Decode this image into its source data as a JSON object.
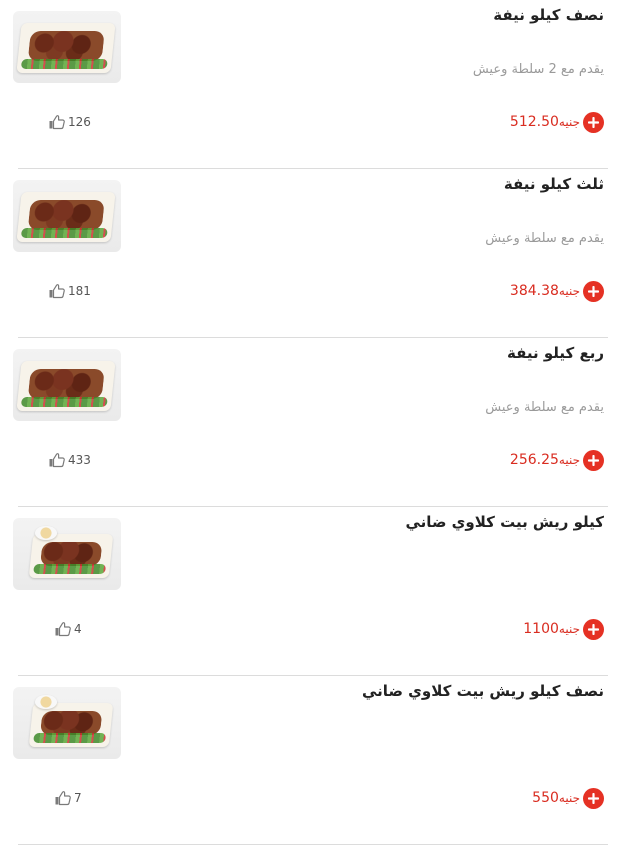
{
  "colors": {
    "accent": "#e53124",
    "price": "#d92c20",
    "subtitle": "#9a9a9a",
    "divider": "#dcdcdc"
  },
  "icons": {
    "add": "plus-circle-icon",
    "like": "thumbs-up-icon"
  },
  "items": [
    {
      "title": "نصف كيلو نيفة",
      "subtitle": "يقدم مع 2 سلطة وعيش",
      "price": "512.50",
      "currency": "جنيه",
      "likes": "126"
    },
    {
      "title": "ثلث كيلو نيفة",
      "subtitle": "يقدم مع سلطة وعيش",
      "price": "384.38",
      "currency": "جنيه",
      "likes": "181"
    },
    {
      "title": "ربع كيلو نيفة",
      "subtitle": "يقدم مع سلطة وعيش",
      "price": "256.25",
      "currency": "جنيه",
      "likes": "433"
    },
    {
      "title": "كيلو ريش بيت كلاوي ضاني",
      "subtitle": "",
      "price": "1100",
      "currency": "جنيه",
      "likes": "4"
    },
    {
      "title": "نصف كيلو ريش بيت كلاوي ضاني",
      "subtitle": "",
      "price": "550",
      "currency": "جنيه",
      "likes": "7"
    }
  ]
}
